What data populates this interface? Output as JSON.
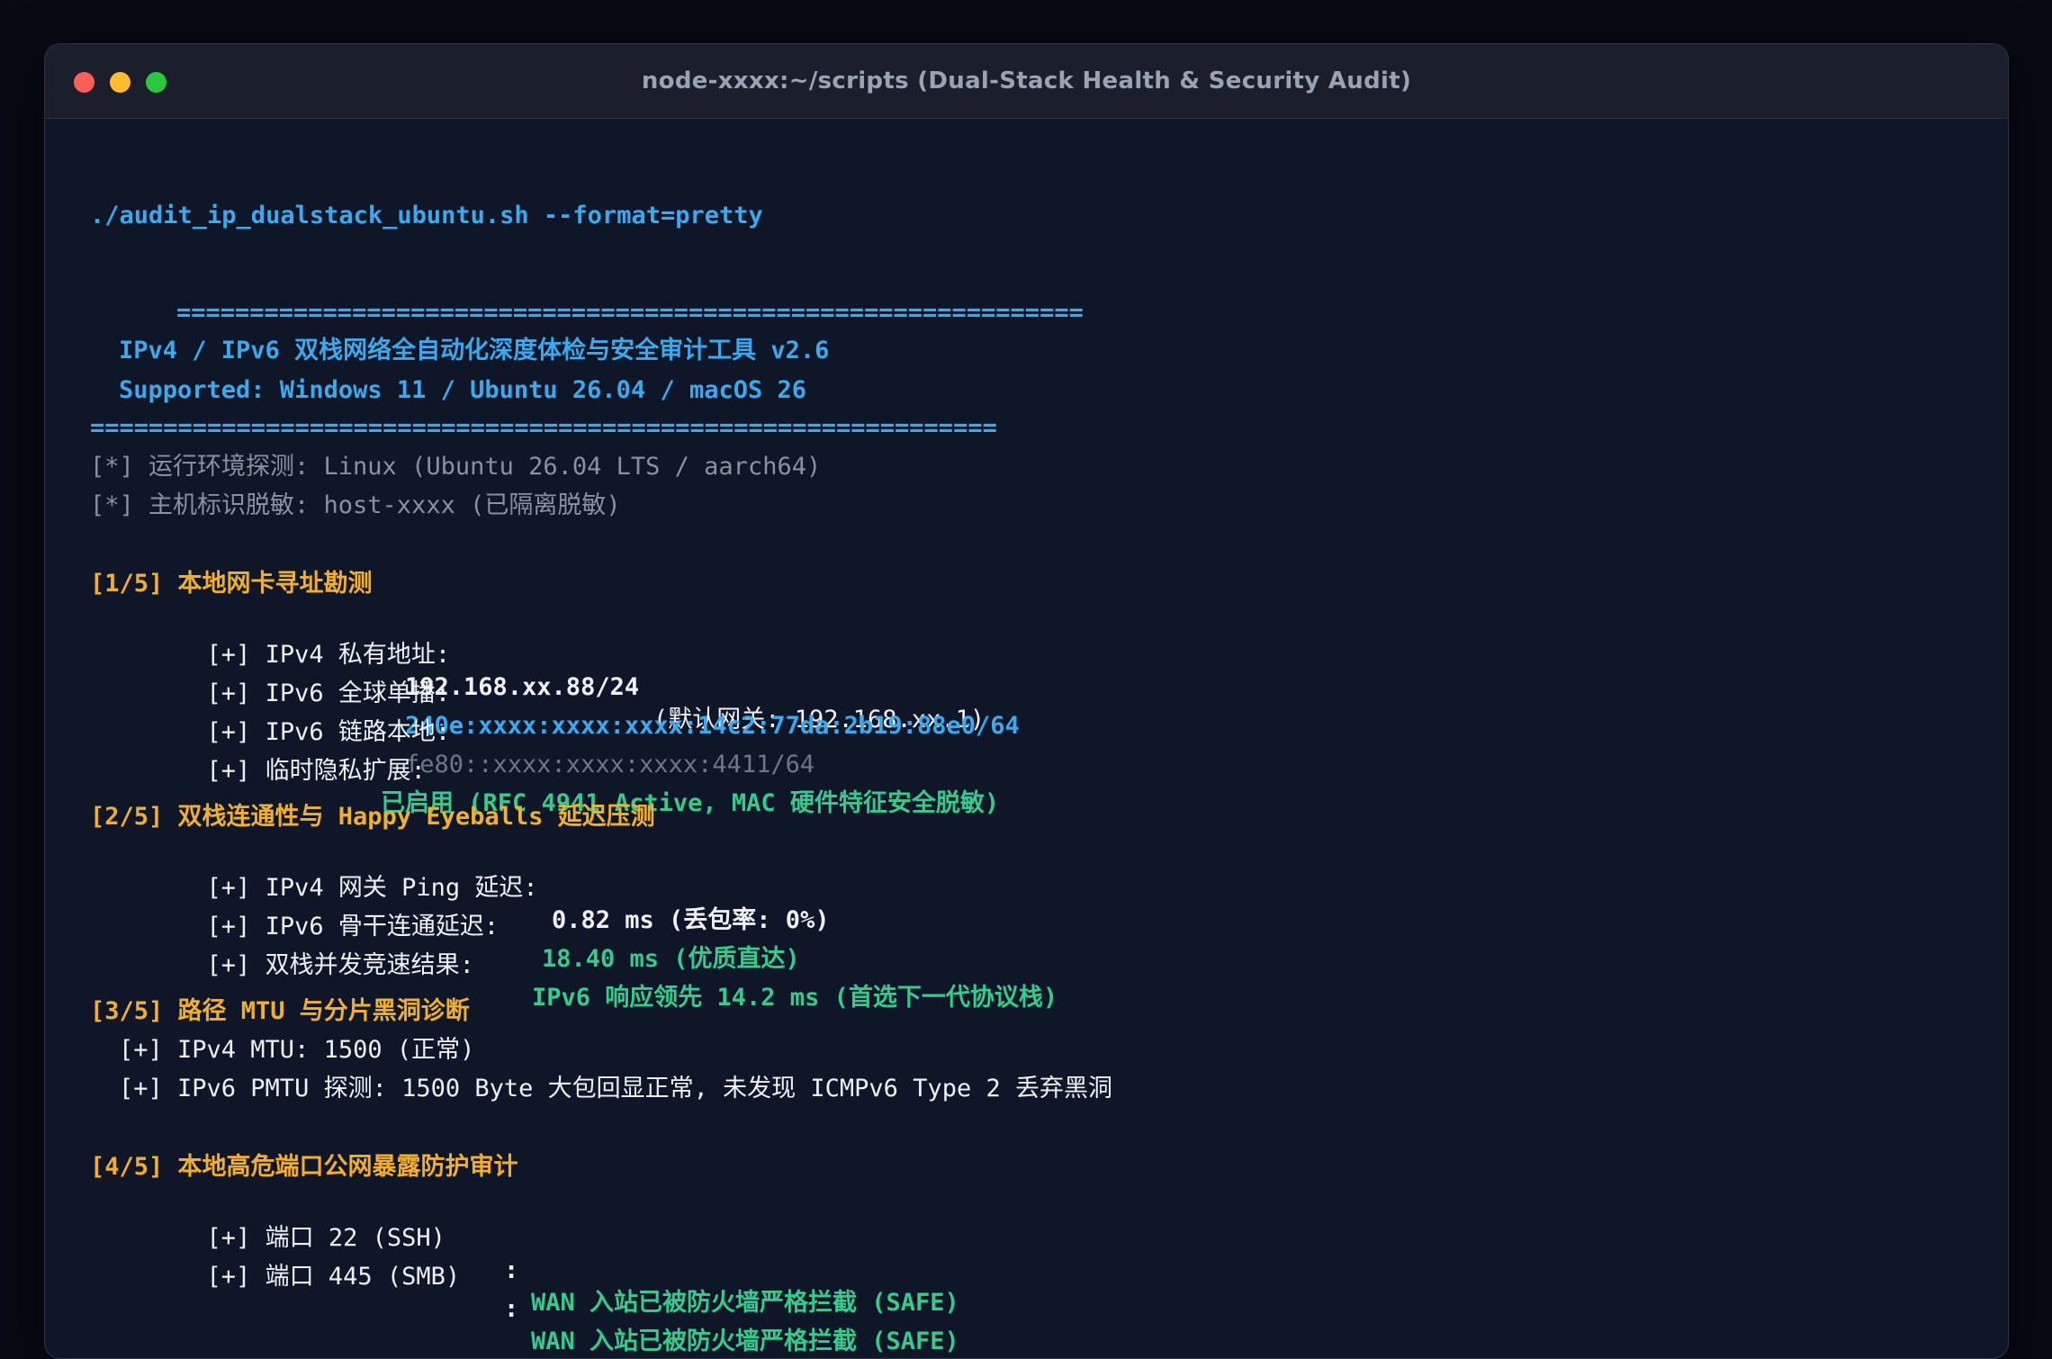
{
  "window": {
    "title": "node-xxxx:~/scripts (Dual-Stack Health & Security Audit)"
  },
  "terminal": {
    "command": "./audit_ip_dualstack_ubuntu.sh --format=pretty",
    "banner_rule_top": "==============================================================",
    "banner_title": "IPv4 / IPv6 双栈网络全自动化深度体检与安全审计工具 v2.6",
    "banner_supported": "Supported: Windows 11 / Ubuntu 26.04 / macOS 26",
    "banner_rule_bottom": "==============================================================",
    "env_line": "[*] 运行环境探测: Linux (Ubuntu 26.04 LTS / aarch64)",
    "host_line": "[*] 主机标识脱敏: host-xxxx (已隔离脱敏)",
    "section1": {
      "header": "[1/5] 本地网卡寻址勘测",
      "ipv4_label": "[+] IPv4 私有地址:",
      "ipv4_value": "192.168.xx.88/24",
      "ipv4_gateway": "(默认网关: 192.168.xx.1)",
      "ipv6_global_label": "[+] IPv6 全球单播:",
      "ipv6_global_value": "240e:xxxx:xxxx:xxxx:14c2:77da:2b19:88e0/64",
      "ipv6_link_label": "[+] IPv6 链路本地:",
      "ipv6_link_value": "fe80::xxxx:xxxx:xxxx:4411/64",
      "privacy_label": "[+] 临时隐私扩展:",
      "privacy_value": "已启用 (RFC 4941 Active, MAC 硬件特征安全脱敏)"
    },
    "section2": {
      "header": "[2/5] 双栈连通性与 Happy Eyeballs 延迟压测",
      "ipv4_ping_label": "[+] IPv4 网关 Ping 延迟:",
      "ipv4_ping_value": "0.82 ms (丢包率: 0%)",
      "ipv6_backbone_label": "[+] IPv6 骨干连通延迟:",
      "ipv6_backbone_value": "18.40 ms (优质直达)",
      "race_label": "[+] 双栈并发竞速结果:",
      "race_value": "IPv6 响应领先 14.2 ms (首选下一代协议栈)"
    },
    "section3": {
      "header": "[3/5] 路径 MTU 与分片黑洞诊断",
      "ipv4_mtu": "[+] IPv4 MTU: 1500 (正常)",
      "ipv6_pmtu": "[+] IPv6 PMTU 探测: 1500 Byte 大包回显正常, 未发现 ICMPv6 Type 2 丢弃黑洞"
    },
    "section4": {
      "header": "[4/5] 本地高危端口公网暴露防护审计",
      "port22_label": "[+] 端口 22 (SSH)",
      "port22_sep": ":",
      "port22_value": "WAN 入站已被防火墙严格拦截 (SAFE)",
      "port445_label": "[+] 端口 445 (SMB)",
      "port445_sep": ":",
      "port445_value": "WAN 入站已被防火墙严格拦截 (SAFE)"
    }
  }
}
